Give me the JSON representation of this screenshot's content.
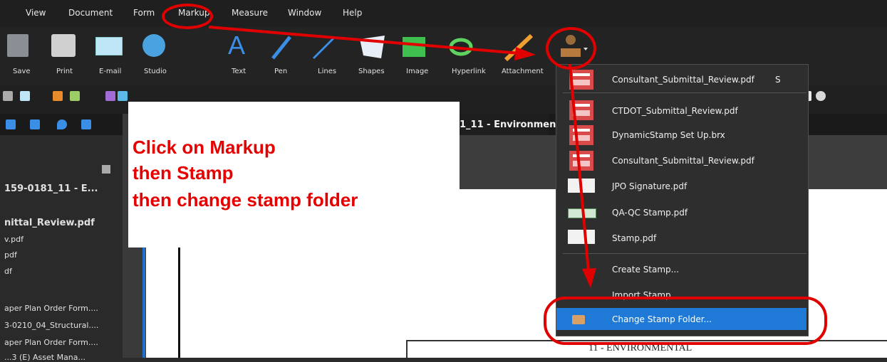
{
  "menubar": {
    "items": [
      "View",
      "Document",
      "Form",
      "Markup",
      "Measure",
      "Window",
      "Help"
    ]
  },
  "ribbon": {
    "labels": [
      "Save",
      "Print",
      "E-mail",
      "Studio",
      "Text",
      "Pen",
      "Lines",
      "Shapes",
      "Image",
      "Hyperlink",
      "Attachment"
    ]
  },
  "doc_tab_title": "1_11 - Environmen",
  "instruction": {
    "line1": "Click on Markup",
    "line2": "then Stamp",
    "line3": "then change stamp folder"
  },
  "left_panel": {
    "items": [
      "159-0181_11 - E...",
      "nittal_Review.pdf",
      "v.pdf",
      "pdf",
      "df",
      "aper Plan Order Form....",
      "3-0210_04_Structural....",
      "aper Plan Order Form....",
      "...3 (E) Asset Mana..."
    ]
  },
  "stamp_menu": {
    "items": [
      {
        "label": "Consultant_Submittal_Review.pdf",
        "shortcut": "S"
      },
      {
        "label": "CTDOT_Submittal_Review.pdf"
      },
      {
        "label": "DynamicStamp Set Up.brx"
      },
      {
        "label": "Consultant_Submittal_Review.pdf"
      },
      {
        "label": "JPO Signature.pdf"
      },
      {
        "label": "QA-QC Stamp.pdf"
      },
      {
        "label": "Stamp.pdf"
      },
      {
        "label": "Create Stamp..."
      },
      {
        "label": "Import Stamp..."
      },
      {
        "label": "Change Stamp Folder..."
      }
    ]
  },
  "doc_page_text": "11 - ENVIRONMENTAL",
  "colors": {
    "annotation_red": "#e00000",
    "highlight_blue": "#1e7ad6"
  }
}
